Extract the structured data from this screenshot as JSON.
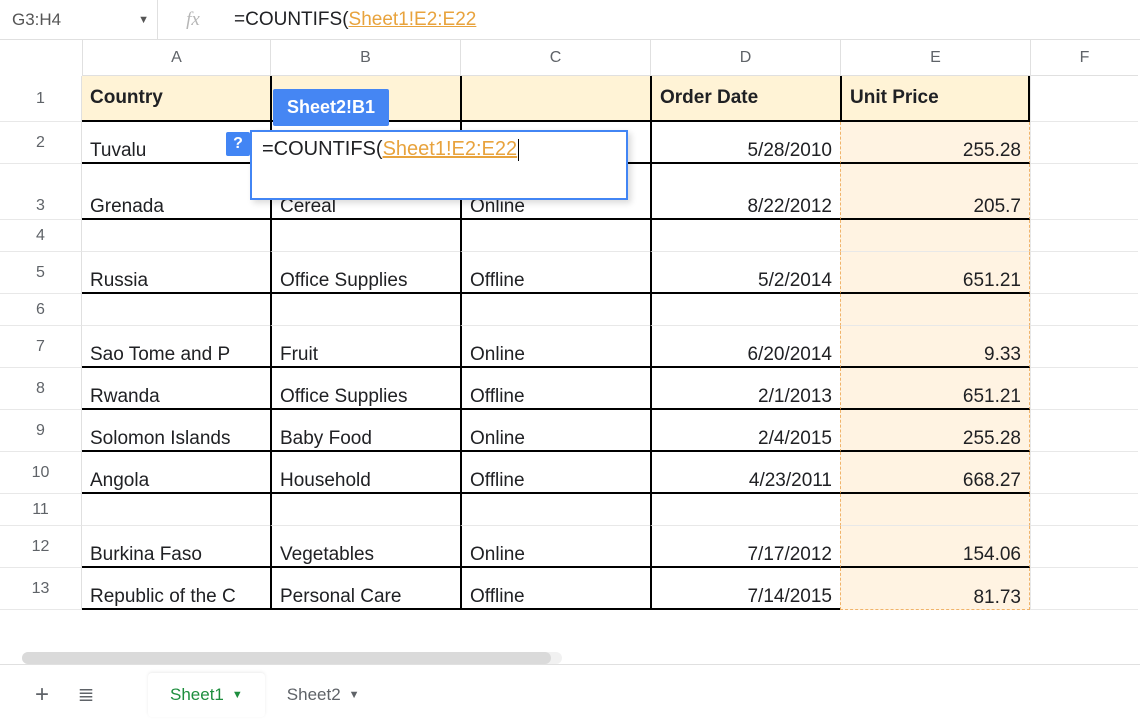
{
  "formula_bar": {
    "name_box": "G3:H4",
    "fx_label": "fx",
    "formula_prefix": "=COUNTIFS(",
    "formula_ref": "Sheet1!E2:E22"
  },
  "tooltip": "Sheet2!B1",
  "edit_cell": {
    "help": "?",
    "prefix": "=COUNTIFS(",
    "ref": "Sheet1!E2:E22"
  },
  "columns": [
    "A",
    "B",
    "C",
    "D",
    "E",
    "F"
  ],
  "row_numbers": [
    "1",
    "2",
    "3",
    "4",
    "5",
    "6",
    "7",
    "8",
    "9",
    "10",
    "11",
    "12",
    "13"
  ],
  "headers": {
    "A": "Country",
    "D": "Order Date",
    "E": "Unit Price"
  },
  "rows": [
    {
      "A": "Tuvalu",
      "B": "",
      "C": "",
      "D": "5/28/2010",
      "E": "255.28"
    },
    {
      "A": "Grenada",
      "B": "Cereal",
      "C": "Online",
      "D": "8/22/2012",
      "E": "205.7"
    },
    {
      "A": "",
      "B": "",
      "C": "",
      "D": "",
      "E": ""
    },
    {
      "A": "Russia",
      "B": "Office Supplies",
      "C": "Offline",
      "D": "5/2/2014",
      "E": "651.21"
    },
    {
      "A": "",
      "B": "",
      "C": "",
      "D": "",
      "E": ""
    },
    {
      "A": "Sao Tome and P",
      "B": "Fruit",
      "C": "Online",
      "D": "6/20/2014",
      "E": "9.33"
    },
    {
      "A": "Rwanda",
      "B": "Office Supplies",
      "C": "Offline",
      "D": "2/1/2013",
      "E": "651.21"
    },
    {
      "A": "Solomon Islands",
      "B": "Baby Food",
      "C": "Online",
      "D": "2/4/2015",
      "E": "255.28"
    },
    {
      "A": "Angola",
      "B": "Household",
      "C": "Offline",
      "D": "4/23/2011",
      "E": "668.27"
    },
    {
      "A": "",
      "B": "",
      "C": "",
      "D": "",
      "E": ""
    },
    {
      "A": "Burkina Faso",
      "B": "Vegetables",
      "C": "Online",
      "D": "7/17/2012",
      "E": "154.06"
    },
    {
      "A": "Republic of the C",
      "B": "Personal Care",
      "C": "Offline",
      "D": "7/14/2015",
      "E": "81.73"
    }
  ],
  "tabs": {
    "add": "+",
    "menu": "≣",
    "sheet1": "Sheet1",
    "sheet2": "Sheet2"
  }
}
